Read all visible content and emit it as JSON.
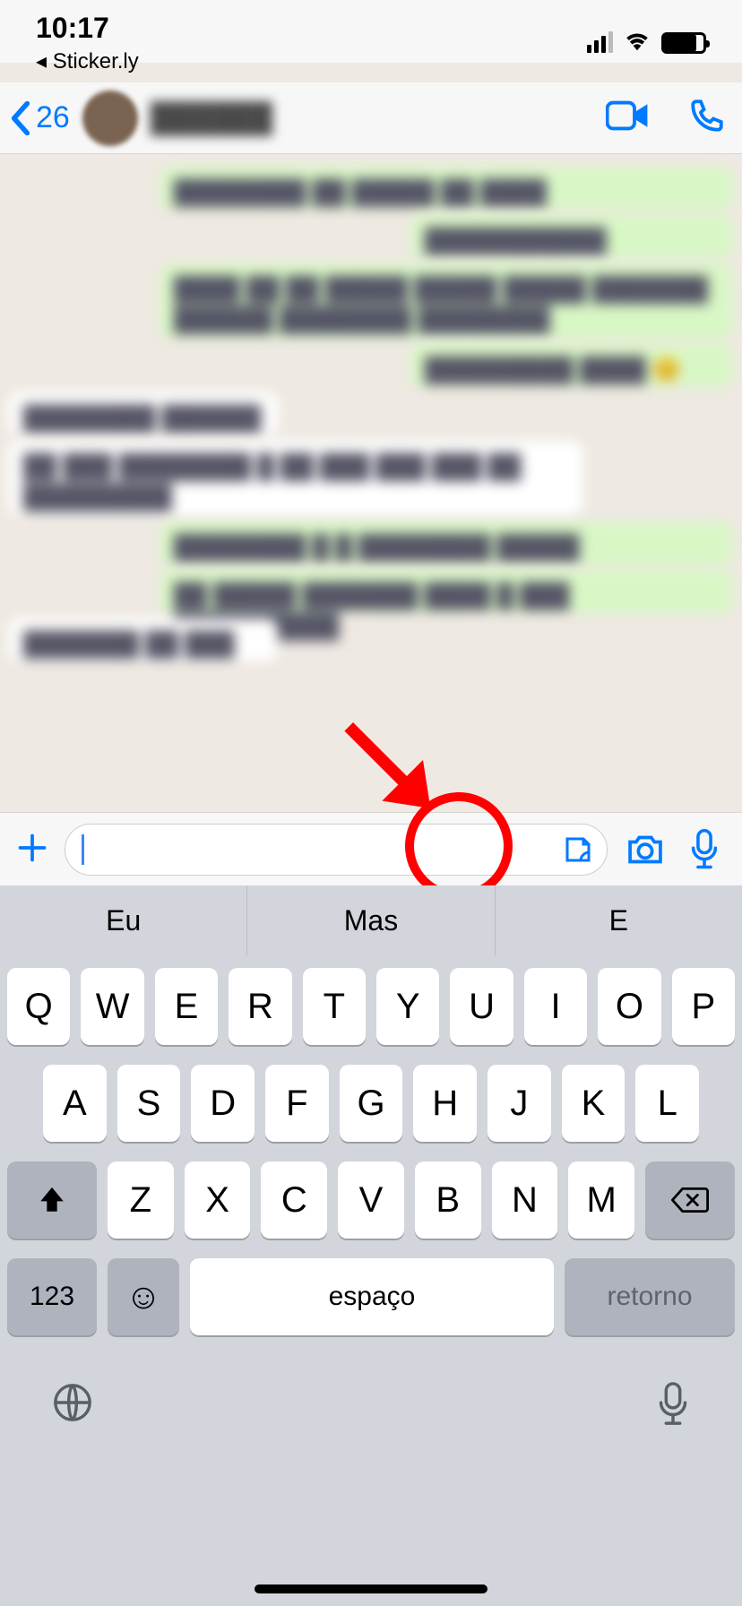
{
  "status": {
    "time": "10:17",
    "back_app": "◂ Sticker.ly"
  },
  "header": {
    "unread_count": "26",
    "contact_name": "██████"
  },
  "messages": [
    {
      "dir": "sent",
      "text": "████████ ██ █████ ██ ████",
      "size": "wide short"
    },
    {
      "dir": "sent",
      "text": "███████████",
      "size": "mid short"
    },
    {
      "dir": "sent",
      "text": "████ ██ ██ █████ █████ █████ ███████ ██████ ████████ ████████",
      "size": "wide tall"
    },
    {
      "dir": "sent",
      "text": "█████████ ████ 😊",
      "size": "mid short"
    },
    {
      "dir": "recv",
      "text": "████████ ██████",
      "size": "narrow short"
    },
    {
      "dir": "recv",
      "text": "██ ███ ████████ █ ██ ███ ███ ███ ██ █████████",
      "size": "wide tall"
    },
    {
      "dir": "sent",
      "text": "████████ █ █ ████████ █████",
      "size": "wide short"
    },
    {
      "dir": "sent",
      "text": "██ █████ ███████ ████ █ ███ ██████████",
      "size": "wide short"
    },
    {
      "dir": "recv",
      "text": "███████ ██ ███",
      "size": "narrow short"
    }
  ],
  "input": {
    "placeholder": ""
  },
  "predictive": {
    "s1": "Eu",
    "s2": "Mas",
    "s3": "E"
  },
  "keyboard": {
    "row1": [
      "Q",
      "W",
      "E",
      "R",
      "T",
      "Y",
      "U",
      "I",
      "O",
      "P"
    ],
    "row2": [
      "A",
      "S",
      "D",
      "F",
      "G",
      "H",
      "J",
      "K",
      "L"
    ],
    "row3": [
      "Z",
      "X",
      "C",
      "V",
      "B",
      "N",
      "M"
    ],
    "numbers": "123",
    "space": "espaço",
    "return": "retorno"
  }
}
